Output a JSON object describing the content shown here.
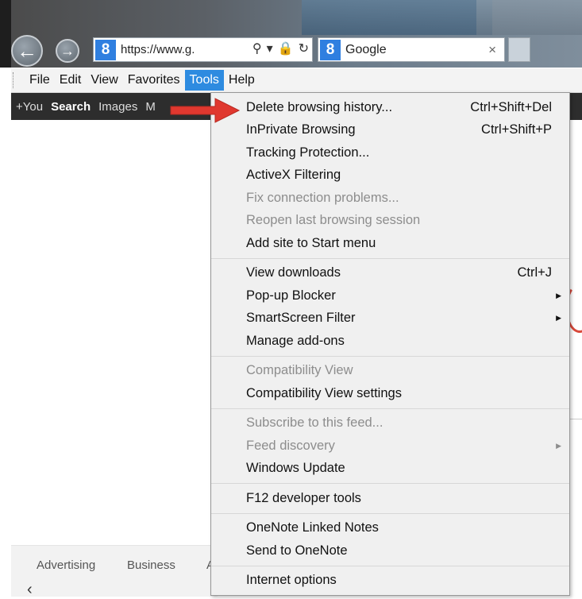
{
  "browser": {
    "address_url": "https://www.g.",
    "tab_title": "Google",
    "tab_close_glyph": "×"
  },
  "menubar": {
    "items": [
      "File",
      "Edit",
      "View",
      "Favorites",
      "Tools",
      "Help"
    ],
    "active": "Tools"
  },
  "google_bar": {
    "items": [
      "+You",
      "Search",
      "Images",
      "M"
    ],
    "selected": "Search"
  },
  "footer": {
    "links": [
      "Advertising",
      "Business",
      "A"
    ]
  },
  "dropdown": {
    "groups": [
      [
        {
          "label": "Delete browsing history...",
          "shortcut": "Ctrl+Shift+Del",
          "enabled": true
        },
        {
          "label": "InPrivate Browsing",
          "shortcut": "Ctrl+Shift+P",
          "enabled": true
        },
        {
          "label": "Tracking Protection...",
          "enabled": true
        },
        {
          "label": "ActiveX Filtering",
          "enabled": true
        },
        {
          "label": "Fix connection problems...",
          "enabled": false
        },
        {
          "label": "Reopen last browsing session",
          "enabled": false
        },
        {
          "label": "Add site to Start menu",
          "enabled": true
        }
      ],
      [
        {
          "label": "View downloads",
          "shortcut": "Ctrl+J",
          "enabled": true
        },
        {
          "label": "Pop-up Blocker",
          "submenu": true,
          "enabled": true
        },
        {
          "label": "SmartScreen Filter",
          "submenu": true,
          "enabled": true
        },
        {
          "label": "Manage add-ons",
          "enabled": true
        }
      ],
      [
        {
          "label": "Compatibility View",
          "enabled": false
        },
        {
          "label": "Compatibility View settings",
          "enabled": true
        }
      ],
      [
        {
          "label": "Subscribe to this feed...",
          "enabled": false
        },
        {
          "label": "Feed discovery",
          "submenu": true,
          "enabled": false
        },
        {
          "label": "Windows Update",
          "enabled": true
        }
      ],
      [
        {
          "label": "F12 developer tools",
          "enabled": true
        }
      ],
      [
        {
          "label": "OneNote Linked Notes",
          "enabled": true
        },
        {
          "label": "Send to OneNote",
          "enabled": true
        }
      ],
      [
        {
          "label": "Internet options",
          "enabled": true
        }
      ]
    ]
  },
  "colors": {
    "menu_active_bg": "#2e8be0",
    "arrow": "#e0382f",
    "google_blue": "#2f7fe0"
  }
}
